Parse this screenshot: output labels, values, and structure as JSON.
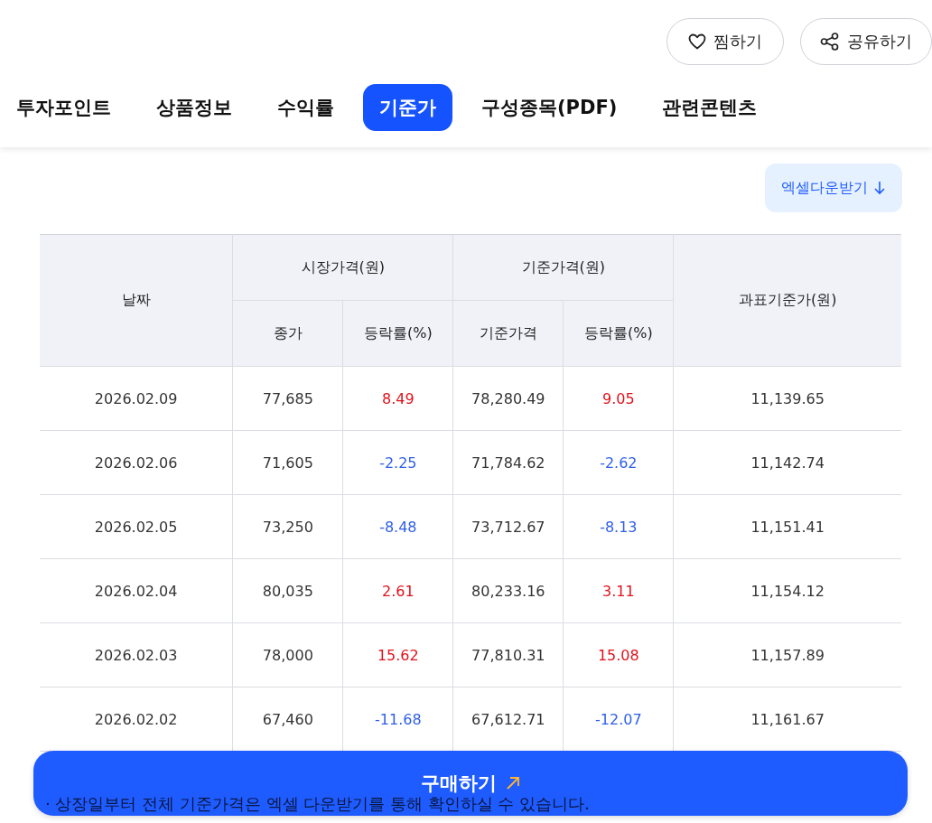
{
  "actions": [
    {
      "kind": "like",
      "label": "찜하기"
    },
    {
      "kind": "share",
      "label": "공유하기"
    }
  ],
  "tabs": [
    {
      "label": "투자포인트",
      "selected": false
    },
    {
      "label": "상품정보",
      "selected": false
    },
    {
      "label": "수익률",
      "selected": false
    },
    {
      "label": "기준가",
      "selected": true
    },
    {
      "label": "구성종목(PDF)",
      "selected": false
    },
    {
      "label": "관련콘텐츠",
      "selected": false
    }
  ],
  "download_button": {
    "label": "엑셀다운받기"
  },
  "table": {
    "headers": {
      "date": "날짜",
      "market": "시장가격(원)",
      "nav_group": "기준가격(원)",
      "tax_base": "과표기준가(원)",
      "close": "종가",
      "close_change": "등락률(%)",
      "nav": "기준가격",
      "nav_change": "등락률(%)"
    },
    "rows": [
      {
        "date": "2026.02.09",
        "close": "77,685",
        "close_change": {
          "value": "8.49",
          "rising": true
        },
        "nav": "78,280.49",
        "nav_change": {
          "value": "9.05",
          "rising": true
        },
        "tax_base": "11,139.65"
      },
      {
        "date": "2026.02.06",
        "close": "71,605",
        "close_change": {
          "value": "-2.25",
          "rising": false
        },
        "nav": "71,784.62",
        "nav_change": {
          "value": "-2.62",
          "rising": false
        },
        "tax_base": "11,142.74"
      },
      {
        "date": "2026.02.05",
        "close": "73,250",
        "close_change": {
          "value": "-8.48",
          "rising": false
        },
        "nav": "73,712.67",
        "nav_change": {
          "value": "-8.13",
          "rising": false
        },
        "tax_base": "11,151.41"
      },
      {
        "date": "2026.02.04",
        "close": "80,035",
        "close_change": {
          "value": "2.61",
          "rising": true
        },
        "nav": "80,233.16",
        "nav_change": {
          "value": "3.11",
          "rising": true
        },
        "tax_base": "11,154.12"
      },
      {
        "date": "2026.02.03",
        "close": "78,000",
        "close_change": {
          "value": "15.62",
          "rising": true
        },
        "nav": "77,810.31",
        "nav_change": {
          "value": "15.08",
          "rising": true
        },
        "tax_base": "11,157.89"
      },
      {
        "date": "2026.02.02",
        "close": "67,460",
        "close_change": {
          "value": "-11.68",
          "rising": false
        },
        "nav": "67,612.71",
        "nav_change": {
          "value": "-12.07",
          "rising": false
        },
        "tax_base": "11,161.67"
      }
    ]
  },
  "note": "· 상장일부터 전체 기준가격은 엑셀 다운받기를 통해 확인하실 수 있습니다.",
  "buy_button": {
    "label": "구매하기"
  }
}
